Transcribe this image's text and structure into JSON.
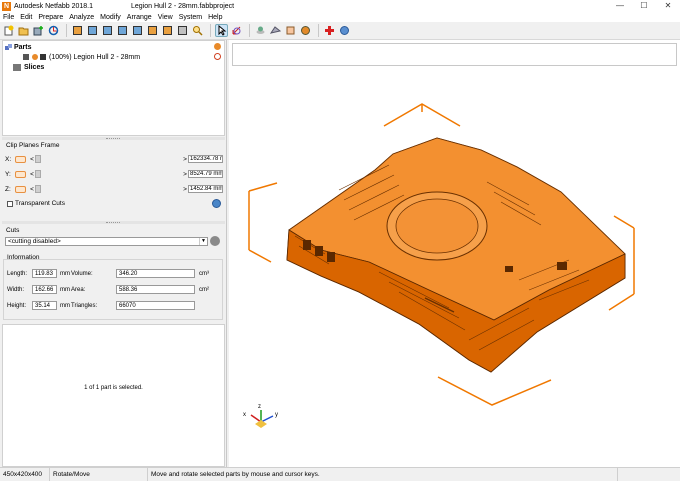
{
  "window": {
    "app_name": "Autodesk Netfabb 2018.1",
    "doc_title": "Legion Hull 2 - 28mm.fabbproject",
    "minimize": "—",
    "maximize": "☐",
    "close": "✕"
  },
  "menu": [
    "File",
    "Edit",
    "Prepare",
    "Analyze",
    "Modify",
    "Arrange",
    "View",
    "System",
    "Help"
  ],
  "tree": {
    "parts_label": "Parts",
    "part_item": "(100%) Legion Hull 2 - 28mm",
    "slices_label": "Slices"
  },
  "clip": {
    "group_title": "Clip Planes Frame",
    "rows": [
      {
        "axis": "X:",
        "value": "162334.78 m"
      },
      {
        "axis": "Y:",
        "value": "8524.79 mm"
      },
      {
        "axis": "Z:",
        "value": "1452.84 mm"
      }
    ],
    "lt": "<",
    "gt": ">",
    "transparent_label": "Transparent Cuts"
  },
  "cuts": {
    "group_title": "Cuts",
    "select_value": "<cutting disabled>",
    "select_arrow": "▼"
  },
  "info": {
    "group_title": "Information",
    "length_label": "Length:",
    "length_value": "119.83",
    "width_label": "Width:",
    "width_value": "162.66",
    "height_label": "Height:",
    "height_value": "35.14",
    "unit_mm": "mm",
    "volume_label": "Volume:",
    "volume_value": "346.20",
    "area_label": "Area:",
    "area_value": "588.36",
    "triangles_label": "Triangles:",
    "triangles_value": "66070",
    "unit_cm3": "cm³",
    "unit_cm2": "cm²"
  },
  "status_message": "1 of 1 part is selected.",
  "statusbar": {
    "dims": "450x420x400",
    "mode": "Rotate/Move",
    "hint": "Move and rotate selected parts by mouse and cursor keys."
  },
  "axes": {
    "x": "x",
    "y": "y",
    "z": "z"
  },
  "colors": {
    "accent": "#f07800",
    "model": "#f07a10"
  }
}
